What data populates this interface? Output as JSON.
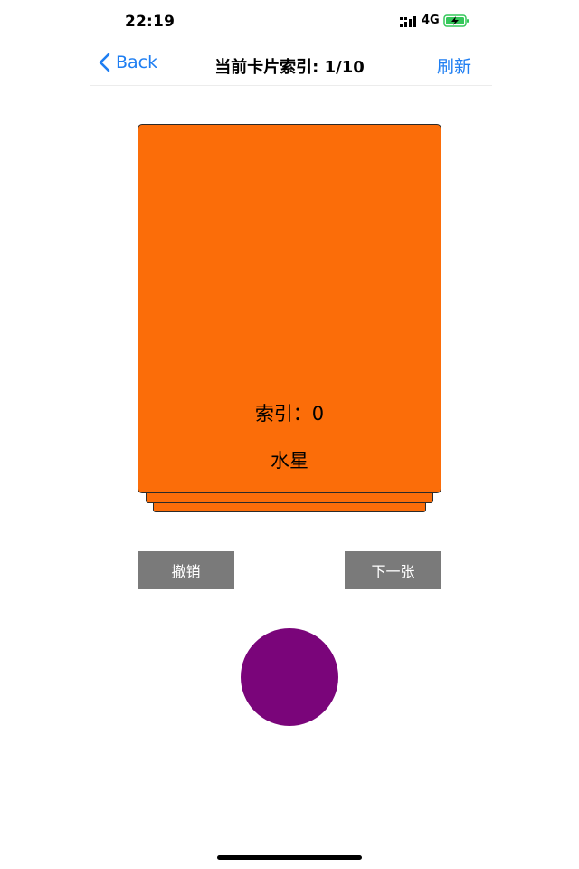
{
  "status_bar": {
    "time": "22:19",
    "network": "4G",
    "icons": [
      "signal-bars-icon",
      "battery-charging-icon"
    ],
    "battery_color": "#34c759"
  },
  "nav": {
    "back_label": "Back",
    "title": "当前卡片索引: 1/10",
    "action_label": "刷新",
    "accent_color": "#1e7ef2"
  },
  "card": {
    "index_text": "索引：0",
    "name": "水星",
    "color": "#fb6d09"
  },
  "buttons": {
    "undo_label": "撤销",
    "next_label": "下一张",
    "color": "#7a7a7a"
  },
  "circle": {
    "color": "#7a057a"
  }
}
